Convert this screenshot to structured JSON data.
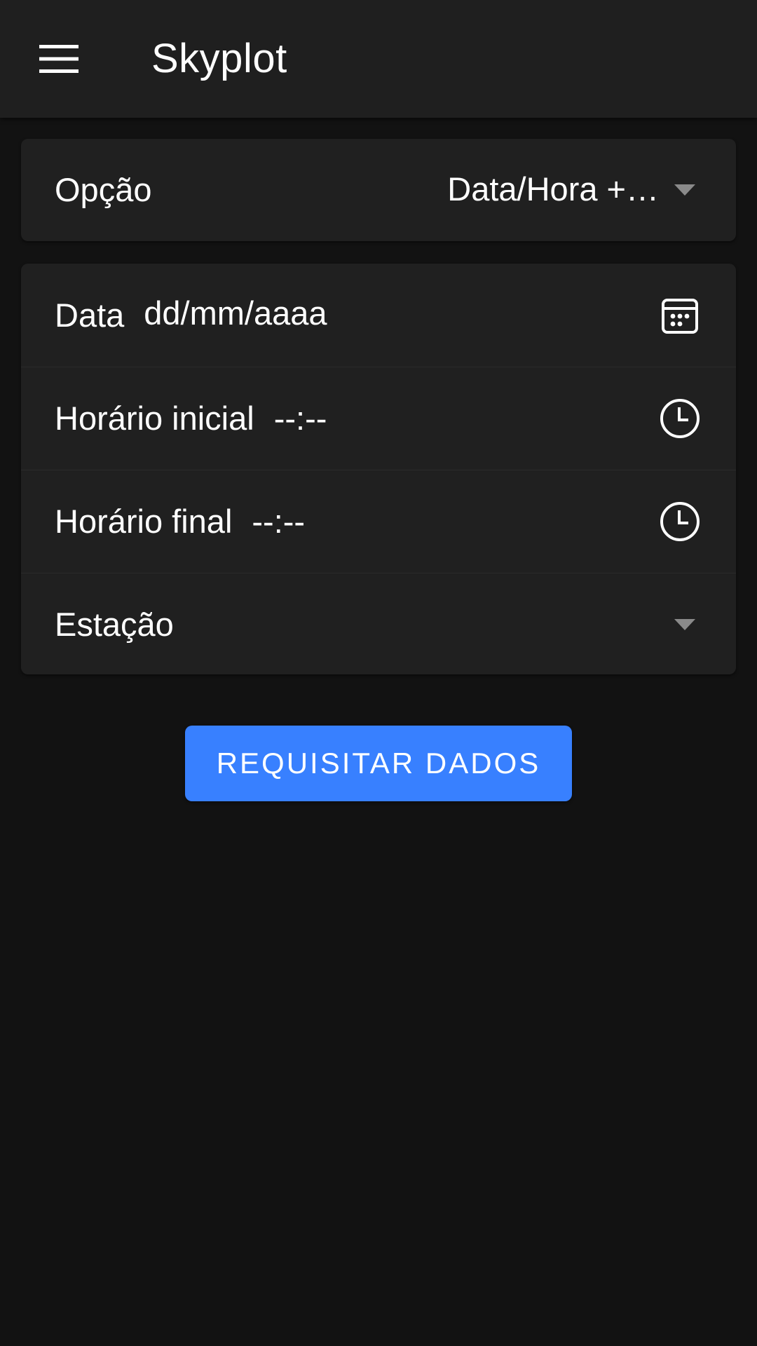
{
  "header": {
    "title": "Skyplot",
    "menu_icon": "menu-icon"
  },
  "option": {
    "label": "Opção",
    "selected": "Data/Hora +…"
  },
  "form": {
    "date": {
      "label": "Data",
      "placeholder": "dd/mm/aaaa",
      "icon": "calendar-icon"
    },
    "start_time": {
      "label": "Horário inicial",
      "placeholder": "--:--",
      "icon": "clock-icon"
    },
    "end_time": {
      "label": "Horário final",
      "placeholder": "--:--",
      "icon": "clock-icon"
    },
    "station": {
      "label": "Estação",
      "selected": ""
    }
  },
  "actions": {
    "request_label": "REQUISITAR DADOS"
  },
  "colors": {
    "background": "#121212",
    "toolbar": "#1f1f1f",
    "card": "#202020",
    "primary": "#3880ff",
    "caret": "#8a8a8a"
  }
}
